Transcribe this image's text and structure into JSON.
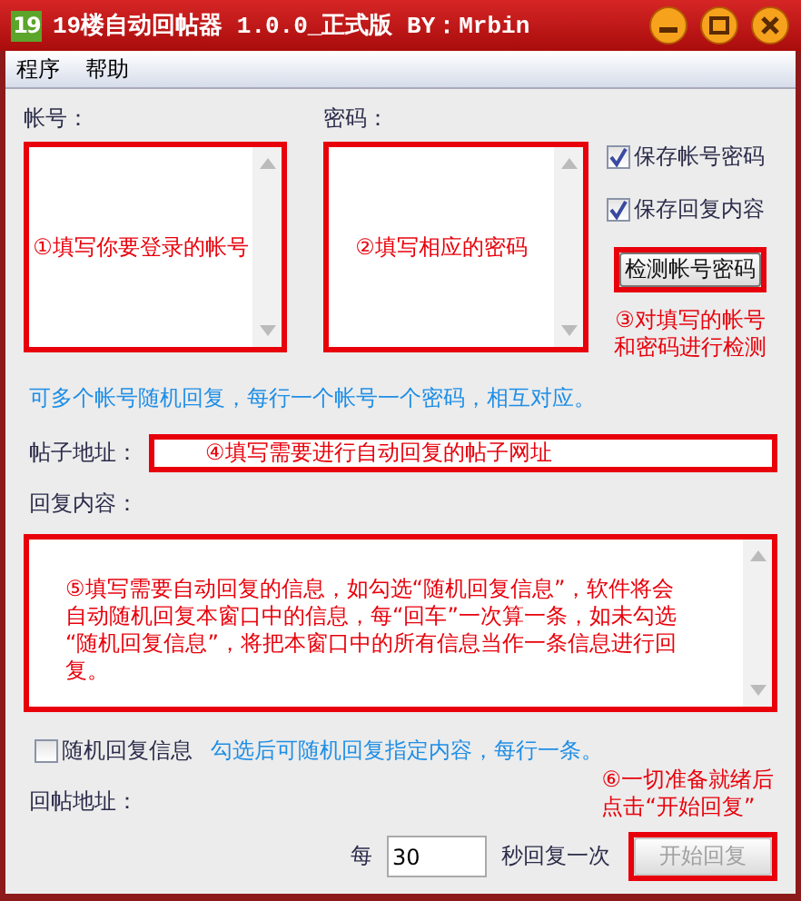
{
  "window": {
    "logo": "19",
    "title": "19楼自动回帖器 1.0.0_正式版 BY：Mrbin"
  },
  "menu": [
    "程序",
    "帮助"
  ],
  "account": {
    "label": "帐号：",
    "annotation": "①填写你要登录的帐号",
    "highlighted": true
  },
  "password": {
    "label": "密码：",
    "annotation": "②填写相应的密码",
    "highlighted": true
  },
  "options": [
    {
      "label": "保存帐号密码",
      "checked": true
    },
    {
      "label": "保存回复内容",
      "checked": true
    }
  ],
  "check_button": {
    "label": "检测帐号密码",
    "highlighted": true,
    "annotation": [
      "③对填写的帐号",
      "和密码进行检测"
    ]
  },
  "account_hint": "可多个帐号随机回复，每行一个帐号一个密码，相互对应。",
  "post_url": {
    "label": "帖子地址：",
    "annotation": "④填写需要进行自动回复的帖子网址",
    "highlighted": true
  },
  "reply": {
    "label": "回复内容：",
    "annotation": [
      "⑤填写需要自动回复的信息，如勾选“随机回复信息”，软件将会",
      "自动随机回复本窗口中的信息，每“回车”一次算一条，如未勾选",
      "“随机回复信息”，将把本窗口中的所有信息当作一条信息进行回",
      "复。"
    ],
    "highlighted": true
  },
  "random": {
    "label": "随机回复信息",
    "checked": false,
    "hint": "勾选后可随机回复指定内容，每行一条。"
  },
  "start_annotation": [
    "⑥一切准备就绪后",
    "点击“开始回复”"
  ],
  "reply_url_label": "回帖地址：",
  "interval": {
    "prefix": "每",
    "value": "30",
    "suffix": "秒回复一次"
  },
  "start_button": {
    "label": "开始回复",
    "disabled": true,
    "highlighted": true
  }
}
